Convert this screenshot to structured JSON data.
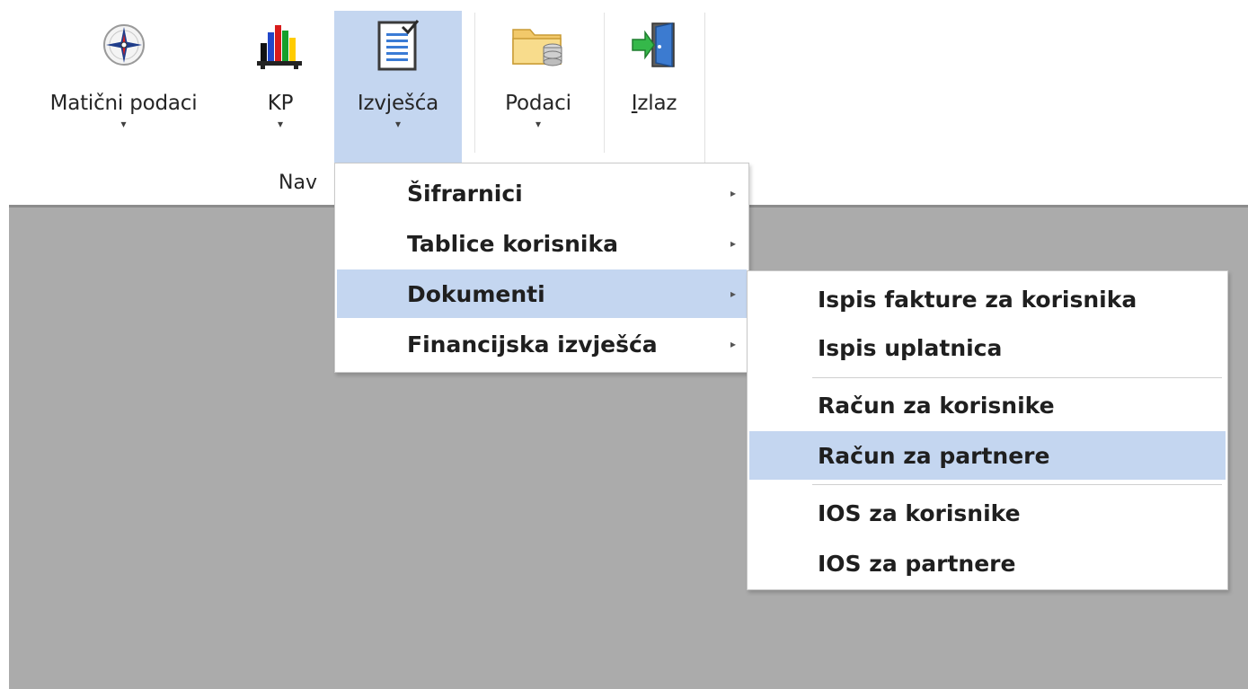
{
  "ribbon": {
    "buttons": [
      {
        "label": "Matični podaci",
        "icon": "compass-icon",
        "has_dropdown": true
      },
      {
        "label": "KP",
        "icon": "bar-chart-icon",
        "has_dropdown": true
      },
      {
        "label": "Izvješća",
        "icon": "report-checklist-icon",
        "has_dropdown": true,
        "active": true
      },
      {
        "label": "Podaci",
        "icon": "folder-database-icon",
        "has_dropdown": true
      },
      {
        "label": "Izlaz",
        "icon": "exit-door-icon",
        "has_dropdown": false
      }
    ],
    "group_label": "Nav",
    "dropdown_arrow": "▾"
  },
  "menu_izvjesca": {
    "items": [
      {
        "label": "Šifrarnici",
        "has_submenu": true
      },
      {
        "label": "Tablice korisnika",
        "has_submenu": true
      },
      {
        "label": "Dokumenti",
        "has_submenu": true,
        "highlighted": true
      },
      {
        "label": "Financijska izvješća",
        "has_submenu": true
      }
    ],
    "submenu_arrow": "▸"
  },
  "menu_dokumenti": {
    "items": [
      {
        "label": "Ispis fakture za korisnika"
      },
      {
        "label": "Ispis uplatnica"
      },
      {
        "label": "Račun za korisnike"
      },
      {
        "label": "Račun za partnere",
        "highlighted": true
      },
      {
        "label": "IOS za korisnike"
      },
      {
        "label": "IOS za partnere"
      }
    ]
  },
  "colors": {
    "highlight": "#c4d6f0",
    "workarea": "#ababab"
  }
}
